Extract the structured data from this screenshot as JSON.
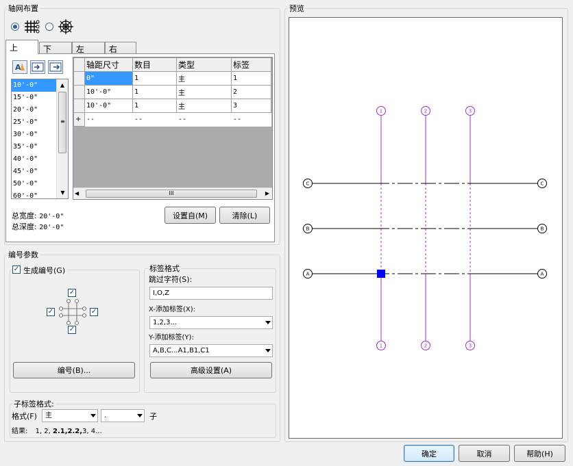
{
  "layout_group": {
    "title": "轴网布置",
    "tabs": [
      "上",
      "下",
      "左",
      "右"
    ],
    "spacing_list": [
      "10'-0\"",
      "15'-0\"",
      "20'-0\"",
      "25'-0\"",
      "30'-0\"",
      "35'-0\"",
      "40'-0\"",
      "45'-0\"",
      "50'-0\"",
      "60'-0\""
    ],
    "grid": {
      "headers": [
        "轴距尺寸",
        "数目",
        "类型",
        "标签"
      ],
      "rows": [
        [
          "0\"",
          "1",
          "主",
          "1"
        ],
        [
          "10'-0\"",
          "1",
          "主",
          "2"
        ],
        [
          "10'-0\"",
          "1",
          "主",
          "3"
        ],
        [
          "--",
          "--",
          "--",
          "--"
        ]
      ],
      "new_row_marker": "+"
    },
    "scroll_thumb_glyph": "III",
    "total_width_label": "总宽度:",
    "total_width_value": "20'-0\"",
    "total_depth_label": "总深度:",
    "total_depth_value": "20'-0\"",
    "set_from_button": "设置自(M)",
    "clear_button": "清除(L)"
  },
  "numbering_group": {
    "title": "编号参数",
    "generate_label": "生成编号(G)",
    "generate_checked": true,
    "number_button": "编号(B)...",
    "label_format_title": "标签格式",
    "skip_chars_label": "跳过字符(S):",
    "skip_chars_value": "I,O,Z",
    "x_label": "X-添加标签(X):",
    "x_value": "1,2,3...",
    "y_label": "Y-添加标签(Y):",
    "y_value": "A,B,C...A1,B1,C1",
    "advanced_button": "高级设置(A)"
  },
  "sub_label": {
    "title": "子标签格式:",
    "format_label": "格式(F)",
    "format_value": "主",
    "separator_value": ".",
    "suffix_text": "子",
    "result_label": "结果:",
    "result_normal1": "1, 2, ",
    "result_bold": "2.1,2.2,",
    "result_normal2": "3, 4..."
  },
  "preview": {
    "title": "预览",
    "columns": [
      "1",
      "2",
      "3"
    ],
    "rows": [
      "C",
      "B",
      "A"
    ],
    "colors": {
      "vertical_axis": "#9b30d9",
      "horizontal_axis": "#000000",
      "marker": "#0000ff"
    }
  },
  "footer": {
    "ok": "确定",
    "cancel": "取消",
    "help": "帮助(H)"
  }
}
